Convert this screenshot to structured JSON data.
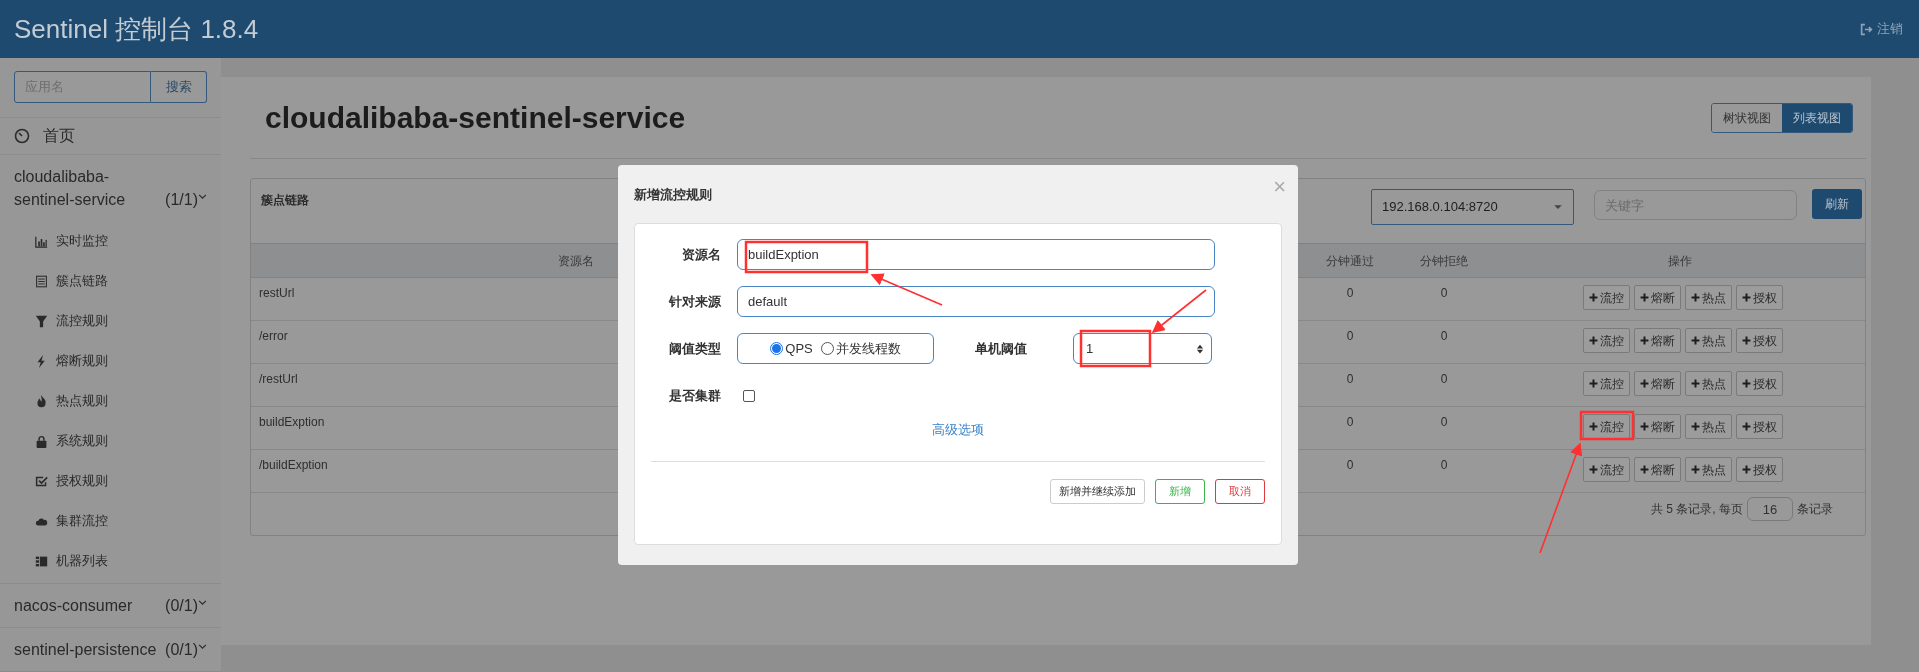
{
  "header": {
    "title": "Sentinel 控制台 1.8.4",
    "logout": "注销"
  },
  "sidebar": {
    "search": {
      "placeholder": "应用名",
      "button": "搜索"
    },
    "home": "首页",
    "apps": [
      {
        "name": "cloudalibaba-sentinel-service",
        "count": "(1/1)",
        "items": [
          "实时监控",
          "簇点链路",
          "流控规则",
          "熔断规则",
          "热点规则",
          "系统规则",
          "授权规则",
          "集群流控",
          "机器列表"
        ]
      },
      {
        "name": "nacos-consumer",
        "count": "(0/1)"
      },
      {
        "name": "sentinel-persistence",
        "count": "(0/1)"
      }
    ]
  },
  "main": {
    "title": "cloudalibaba-sentinel-service",
    "view_toggle": [
      {
        "label": "树状视图",
        "selected": false
      },
      {
        "label": "列表视图",
        "selected": true
      }
    ],
    "card": {
      "title": "簇点链路",
      "machine": "192.168.0.104:8720",
      "keyword_placeholder": "关键字",
      "refresh": "刷新",
      "columns": [
        "资源名",
        "分钟通过",
        "分钟拒绝",
        "操作"
      ],
      "rows": [
        {
          "resource": "restUrl",
          "pass": "0",
          "block": "0",
          "actions": [
            "流控",
            "熔断",
            "热点",
            "授权"
          ]
        },
        {
          "resource": "/error",
          "pass": "0",
          "block": "0",
          "actions": [
            "流控",
            "熔断",
            "热点",
            "授权"
          ]
        },
        {
          "resource": "/restUrl",
          "pass": "0",
          "block": "0",
          "actions": [
            "流控",
            "熔断",
            "热点",
            "授权"
          ]
        },
        {
          "resource": "buildExption",
          "pass": "0",
          "block": "0",
          "actions": [
            "流控",
            "熔断",
            "热点",
            "授权"
          ]
        },
        {
          "resource": "/buildExption",
          "pass": "0",
          "block": "0",
          "actions": [
            "流控",
            "熔断",
            "热点",
            "授权"
          ]
        }
      ],
      "pagination": {
        "summary": "共 5 条记录, 每页",
        "page_size": "16",
        "suffix": "条记录"
      }
    }
  },
  "modal": {
    "title": "新增流控规则",
    "close": "×",
    "resource": {
      "label": "资源名",
      "value": "buildExption"
    },
    "origin": {
      "label": "针对来源",
      "value": "default"
    },
    "threshold_type": {
      "label": "阈值类型",
      "options": [
        {
          "label": "QPS",
          "selected": true
        },
        {
          "label": "并发线程数",
          "selected": false
        }
      ]
    },
    "threshold": {
      "label": "单机阈值",
      "value": "1"
    },
    "cluster": {
      "label": "是否集群",
      "checked": false
    },
    "advanced": "高级选项",
    "buttons": [
      {
        "label": "新增并继续添加",
        "kind": "default"
      },
      {
        "label": "新增",
        "kind": "success"
      },
      {
        "label": "取消",
        "kind": "danger"
      }
    ]
  }
}
